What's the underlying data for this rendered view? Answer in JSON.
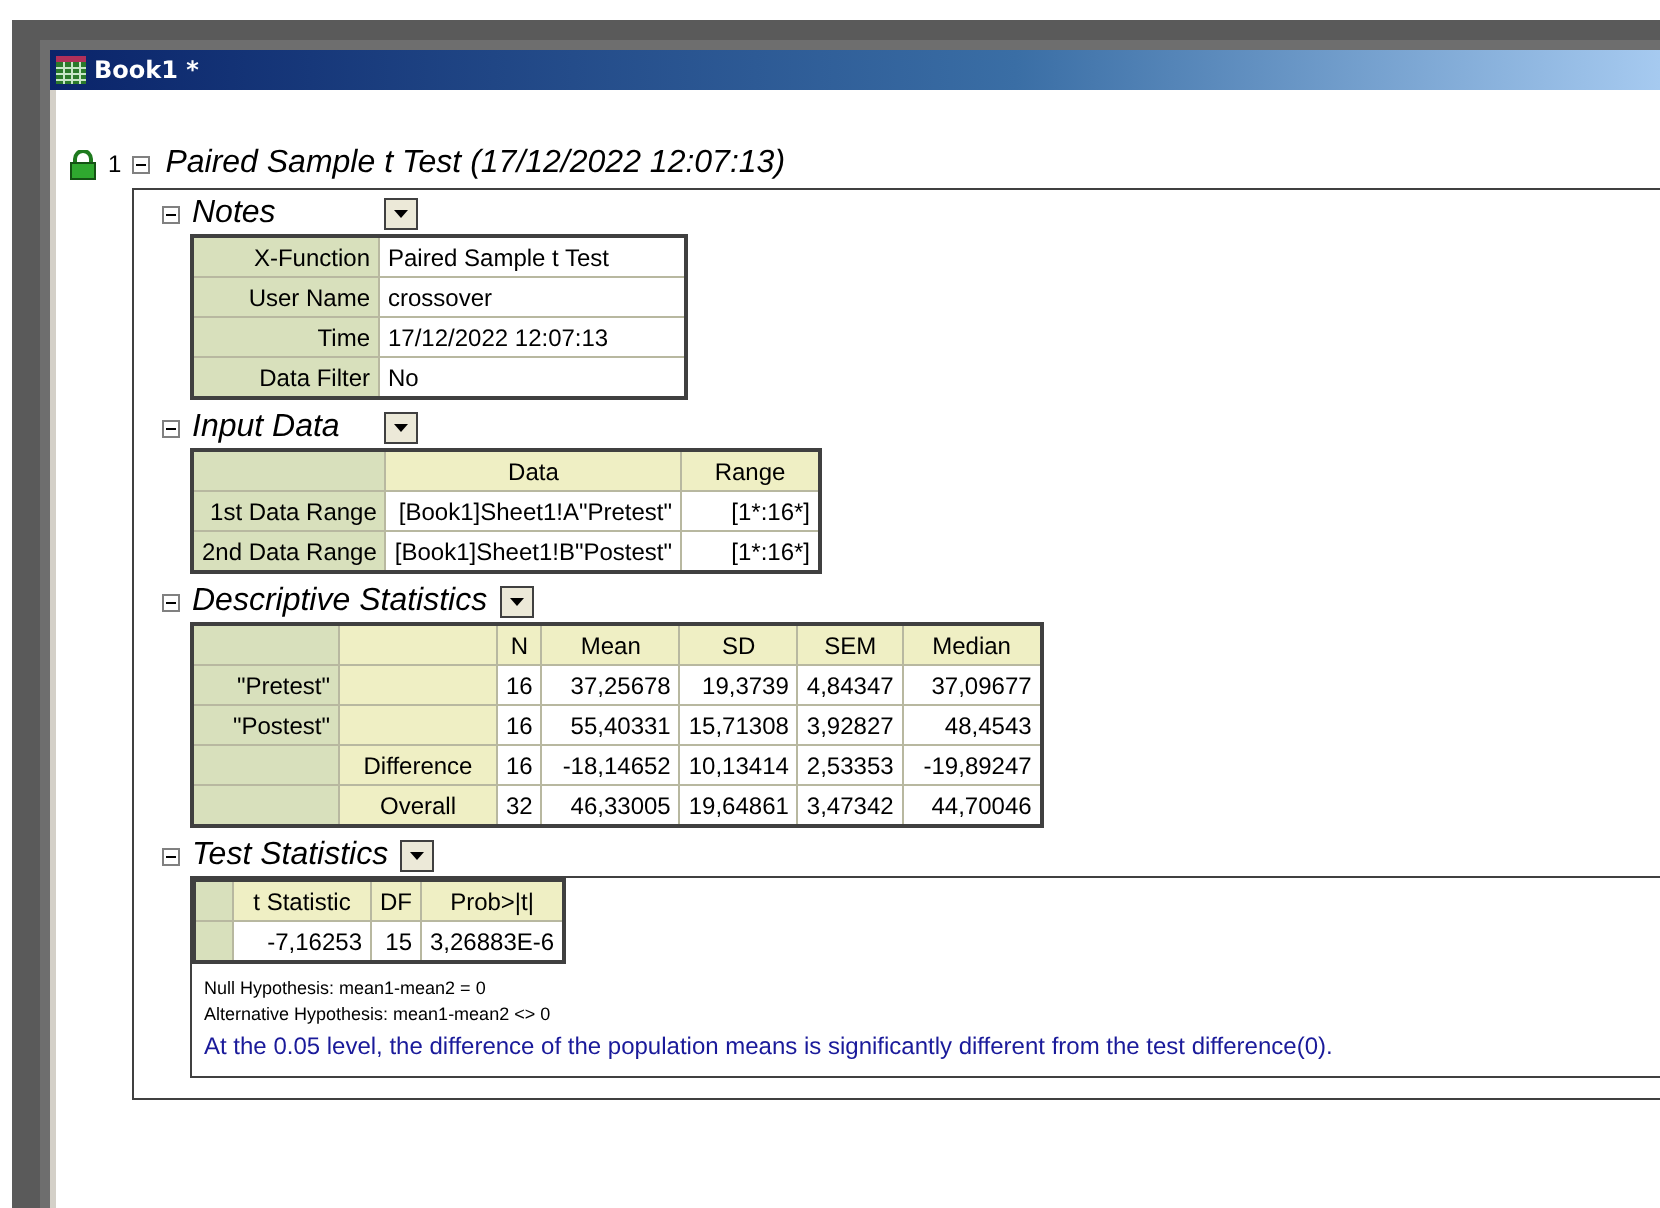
{
  "window": {
    "title": "Book1 *"
  },
  "report": {
    "index": "1",
    "title": "Paired Sample t Test (17/12/2022 12:07:13)",
    "expanded": true,
    "sections": [
      {
        "title": "Notes",
        "kind": "keyvalue",
        "expanded": true,
        "rows": [
          {
            "key": "X-Function",
            "value": "Paired Sample t Test"
          },
          {
            "key": "User Name",
            "value": "crossover"
          },
          {
            "key": "Time",
            "value": "17/12/2022 12:07:13"
          },
          {
            "key": "Data Filter",
            "value": "No"
          }
        ]
      },
      {
        "title": "Input Data",
        "kind": "grid",
        "expanded": true,
        "columns": [
          "Data",
          "Range"
        ],
        "rows": [
          {
            "label": "1st Data Range",
            "values": [
              "[Book1]Sheet1!A\"Pretest\"",
              "[1*:16*]"
            ]
          },
          {
            "label": "2nd Data Range",
            "values": [
              "[Book1]Sheet1!B\"Postest\"",
              "[1*:16*]"
            ]
          }
        ]
      },
      {
        "title": "Descriptive Statistics",
        "kind": "grid",
        "expanded": true,
        "columns": [
          "N",
          "Mean",
          "SD",
          "SEM",
          "Median"
        ],
        "rows": [
          {
            "label": "\"Pretest\"",
            "values": [
              "16",
              "37,25678",
              "19,3739",
              "4,84347",
              "37,09677"
            ]
          },
          {
            "label": "\"Postest\"",
            "values": [
              "16",
              "55,40331",
              "15,71308",
              "3,92827",
              "48,4543"
            ]
          },
          {
            "sublabel": "Difference",
            "values": [
              "16",
              "-18,14652",
              "10,13414",
              "2,53353",
              "-19,89247"
            ]
          },
          {
            "sublabel": "Overall",
            "values": [
              "32",
              "46,33005",
              "19,64861",
              "3,47342",
              "44,70046"
            ]
          }
        ]
      },
      {
        "title": "Test Statistics",
        "kind": "grid",
        "expanded": true,
        "columns": [
          "t Statistic",
          "DF",
          "Prob>|t|"
        ],
        "rows": [
          {
            "values": [
              "-7,16253",
              "15",
              "3,26883E-6"
            ]
          }
        ],
        "notes": [
          "Null Hypothesis: mean1-mean2 = 0",
          "Alternative Hypothesis: mean1-mean2 <> 0"
        ],
        "conclusion": "At the 0.05 level, the difference of the population means is significantly different from the test difference(0)."
      }
    ]
  }
}
